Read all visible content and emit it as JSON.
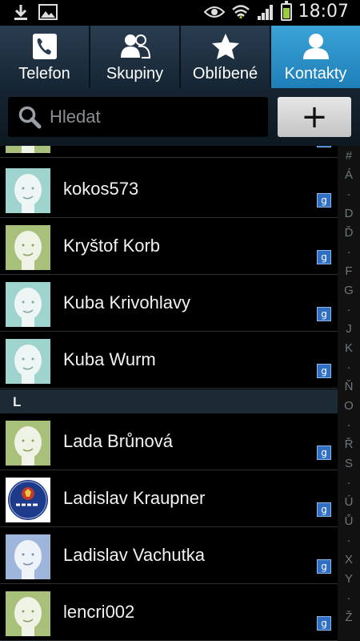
{
  "status_bar": {
    "time": "18:07",
    "left_icons": [
      "download-icon",
      "image-icon"
    ],
    "right_icons": [
      "eye-icon",
      "wifi-icon",
      "signal-icon",
      "battery-icon"
    ],
    "battery_level": 0.7,
    "colors": {
      "battery": "#9ccc3c"
    }
  },
  "tabs": [
    {
      "label": "Telefon",
      "icon": "phone-icon",
      "active": false
    },
    {
      "label": "Skupiny",
      "icon": "group-icon",
      "active": false
    },
    {
      "label": "Oblíbené",
      "icon": "star-icon",
      "active": false
    },
    {
      "label": "Kontakty",
      "icon": "contact-icon",
      "active": true
    }
  ],
  "search": {
    "placeholder": "Hledat",
    "value": ""
  },
  "add_button": {
    "label": "+"
  },
  "section_header": {
    "label": "L"
  },
  "contacts": [
    {
      "name": "",
      "avatar": "green-face",
      "badge": "g"
    },
    {
      "name": "kokos573",
      "avatar": "teal-face",
      "badge": "g"
    },
    {
      "name": "Kryštof Korb",
      "avatar": "green-face",
      "badge": "g"
    },
    {
      "name": "Kuba Krivohlavy",
      "avatar": "teal-face",
      "badge": "g"
    },
    {
      "name": "Kuba Wurm",
      "avatar": "teal-face",
      "badge": "g"
    },
    {
      "name": "Lada Brůnová",
      "avatar": "green-face",
      "badge": "g"
    },
    {
      "name": "Ladislav Kraupner",
      "avatar": "saab-logo",
      "badge": "g"
    },
    {
      "name": "Ladislav Vachutka",
      "avatar": "blue-face",
      "badge": "g"
    },
    {
      "name": "lencri002",
      "avatar": "green-face",
      "badge": "g"
    }
  ],
  "index_letters": [
    "#",
    "Á",
    "·",
    "D",
    "Ď",
    "·",
    "F",
    "G",
    "·",
    "J",
    "K",
    "·",
    "Ň",
    "O",
    "·",
    "Ř",
    "S",
    "·",
    "Ú",
    "Ů",
    "·",
    "X",
    "Y",
    "·",
    "Ž"
  ],
  "colors": {
    "active_tab": "#2b93cf",
    "tab_bg": "#1d3042",
    "avatar_green": "#a9c07a",
    "avatar_teal": "#9fd3cd",
    "avatar_blue": "#9fb6dc",
    "google_badge": "#2f6fc4"
  }
}
